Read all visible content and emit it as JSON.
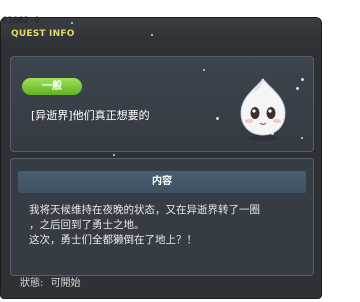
{
  "window": {
    "quest_id": "63062-0",
    "title": "QUEST INFO"
  },
  "quest": {
    "category_badge": "一般",
    "name": "[异逝界]他们真正想要的"
  },
  "description": {
    "header": "内容",
    "lines": [
      "我将天候维持在夜晚的状态，又在异逝界转了一圈",
      "，之后回到了勇士之地。",
      "这次，勇士们全都獭倒在了地上？！"
    ]
  },
  "status": {
    "label": "狀態:",
    "value": "可開始"
  },
  "colors": {
    "window_bg": "#2e3236",
    "title_text": "#e8d86a",
    "badge_green": "#7cc83a",
    "header_bar": "#465a6b"
  },
  "icons": {
    "npc_portrait": "white-spirit-icon"
  }
}
